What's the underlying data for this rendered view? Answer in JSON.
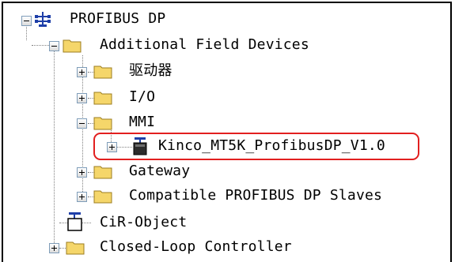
{
  "tree": {
    "root": {
      "label": "PROFIBUS DP",
      "icon": "profibus-network-icon"
    },
    "additional": {
      "label": "Additional Field Devices",
      "icon": "folder-icon"
    },
    "drives": {
      "label": "驱动器",
      "icon": "folder-icon"
    },
    "io": {
      "label": "I/O",
      "icon": "folder-icon"
    },
    "mmi": {
      "label": "MMI",
      "icon": "folder-icon"
    },
    "kinco": {
      "label": "Kinco_MT5K_ProfibusDP_V1.0",
      "icon": "device-module-icon"
    },
    "gateway": {
      "label": "Gateway",
      "icon": "folder-icon"
    },
    "compatible": {
      "label": "Compatible PROFIBUS DP Slaves",
      "icon": "folder-icon"
    },
    "cir": {
      "label": "CiR-Object",
      "icon": "cir-object-icon"
    },
    "closed_loop": {
      "label": "Closed-Loop Controller",
      "icon": "folder-icon"
    }
  },
  "colors": {
    "highlight": "#e21f1f",
    "folder": "#f5d66a",
    "tree_line": "#808080"
  }
}
